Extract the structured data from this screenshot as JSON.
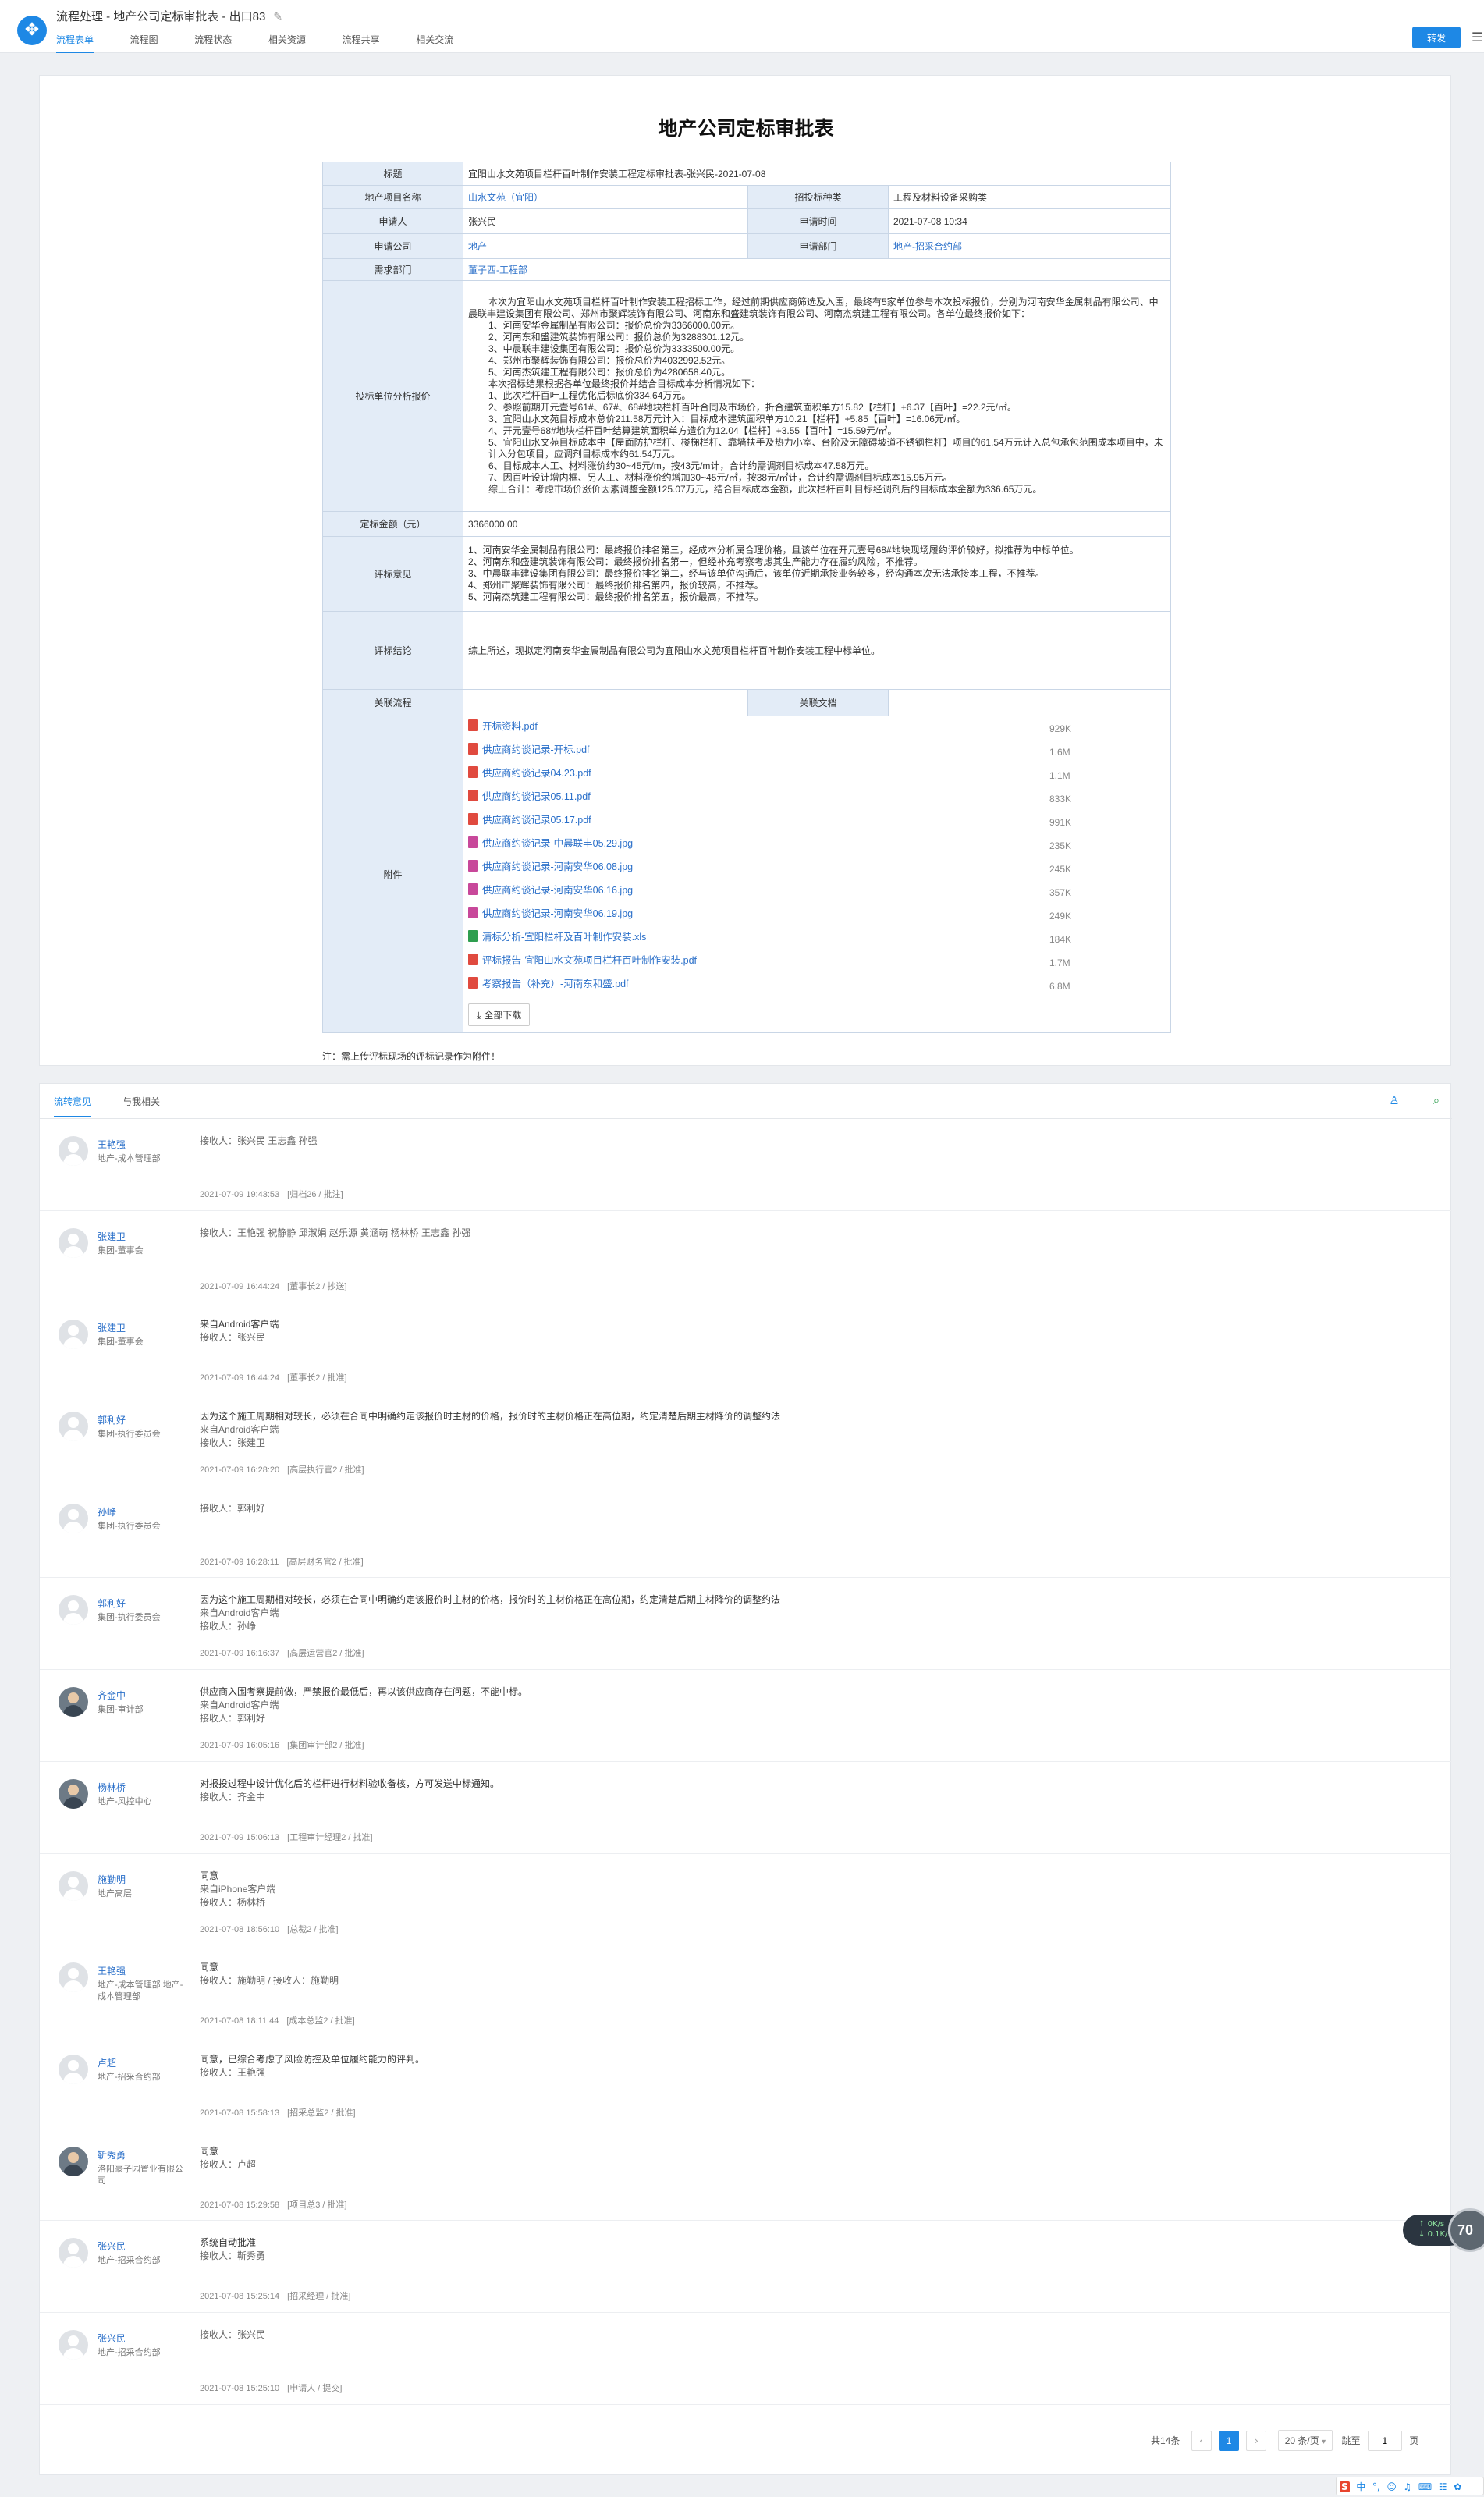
{
  "app": {
    "title": "流程处理 - 地产公司定标审批表 - 出口83",
    "edit_icon": "pencil-icon",
    "logo_icon": "workflow-logo-icon",
    "tabs": [
      "流程表单",
      "流程图",
      "流程状态",
      "相关资源",
      "流程共享",
      "相关交流"
    ],
    "forward_button": "转发",
    "menu_icon": "list-menu-icon",
    "accent_color": "#1e88e5"
  },
  "form": {
    "title": "地产公司定标审批表",
    "labels": {
      "subject": "标题",
      "project": "地产项目名称",
      "bid_type": "招投标种类",
      "applicant": "申请人",
      "apply_time": "申请时间",
      "company": "申请公司",
      "dept": "申请部门",
      "demand_dept": "需求部门",
      "analysis": "投标单位分析报价",
      "amount": "定标金额（元）",
      "opinion": "评标意见",
      "conclusion": "评标结论",
      "related_flow": "关联流程",
      "related_doc": "关联文档",
      "attachments": "附件"
    },
    "values": {
      "subject": "宜阳山水文苑项目栏杆百叶制作安装工程定标审批表-张兴民-2021-07-08",
      "project": "山水文苑（宜阳）",
      "bid_type": "工程及材料设备采购类",
      "applicant": "张兴民",
      "apply_time": "2021-07-08 10:34",
      "company": "地产",
      "dept": "地产-招采合约部",
      "demand_dept": "董子西-工程部",
      "amount": "3366000.00",
      "conclusion": "综上所述，现拟定河南安华金属制品有限公司为宜阳山水文苑项目栏杆百叶制作安装工程中标单位。",
      "related_flow": "",
      "related_doc": ""
    },
    "analysis": [
      "本次为宜阳山水文苑项目栏杆百叶制作安装工程招标工作，经过前期供应商筛选及入围，最终有5家单位参与本次投标报价，分别为河南安华金属制品有限公司、中晨联丰建设集团有限公司、郑州市聚辉装饰有限公司、河南东和盛建筑装饰有限公司、河南杰筑建工程有限公司。各单位最终报价如下：",
      "1、河南安华金属制品有限公司：报价总价为3366000.00元。",
      "2、河南东和盛建筑装饰有限公司：报价总价为3288301.12元。",
      "3、中晨联丰建设集团有限公司：报价总价为3333500.00元。",
      "4、郑州市聚辉装饰有限公司：报价总价为4032992.52元。",
      "5、河南杰筑建工程有限公司：报价总价为4280658.40元。",
      "本次招标结果根据各单位最终报价并结合目标成本分析情况如下：",
      "1、此次栏杆百叶工程优化后标底价334.64万元。",
      "2、参照前期开元壹号61#、67#、68#地块栏杆百叶合同及市场价，折合建筑面积单方15.82【栏杆】+6.37【百叶】=22.2元/㎡。",
      "3、宜阳山水文苑目标成本总价211.58万元计入：目标成本建筑面积单方10.21【栏杆】+5.85【百叶】=16.06元/㎡。",
      "4、开元壹号68#地块栏杆百叶结算建筑面积单方造价为12.04【栏杆】+3.55【百叶】=15.59元/㎡。",
      "5、宜阳山水文苑目标成本中【屋面防护栏杆、楼梯栏杆、靠墙扶手及热力小室、台阶及无障碍坡道不锈钢栏杆】项目的61.54万元计入总包承包范围成本项目中，未计入分包项目，应调剂目标成本约61.54万元。",
      "6、目标成本人工、材料涨价约30~45元/m，按43元/m计，合计约需调剂目标成本47.58万元。",
      "7、因百叶设计增内框、另人工、材料涨价约增加30~45元/㎡，按38元/㎡计，合计约需调剂目标成本15.95万元。",
      "综上合计：考虑市场价涨价因素调整金额125.07万元，结合目标成本金额，此次栏杆百叶目标经调剂后的目标成本金额为336.65万元。"
    ],
    "opinion": [
      "1、河南安华金属制品有限公司：最终报价排名第三，经成本分析属合理价格，且该单位在开元壹号68#地块现场履约评价较好，拟推荐为中标单位。",
      "2、河南东和盛建筑装饰有限公司：最终报价排名第一，但经补充考察考虑其生产能力存在履约风险，不推荐。",
      "3、中晨联丰建设集团有限公司：最终报价排名第二，经与该单位沟通后，该单位近期承接业务较多，经沟通本次无法承接本工程，不推荐。",
      "4、郑州市聚辉装饰有限公司：最终报价排名第四，报价较高，不推荐。",
      "5、河南杰筑建工程有限公司：最终报价排名第五，报价最高，不推荐。"
    ],
    "attachments": [
      {
        "name": "开标资料.pdf",
        "size": "929K",
        "kind": "pdf"
      },
      {
        "name": "供应商约谈记录-开标.pdf",
        "size": "1.6M",
        "kind": "pdf"
      },
      {
        "name": "供应商约谈记录04.23.pdf",
        "size": "1.1M",
        "kind": "pdf"
      },
      {
        "name": "供应商约谈记录05.11.pdf",
        "size": "833K",
        "kind": "pdf"
      },
      {
        "name": "供应商约谈记录05.17.pdf",
        "size": "991K",
        "kind": "pdf"
      },
      {
        "name": "供应商约谈记录-中晨联丰05.29.jpg",
        "size": "235K",
        "kind": "jpg"
      },
      {
        "name": "供应商约谈记录-河南安华06.08.jpg",
        "size": "245K",
        "kind": "jpg"
      },
      {
        "name": "供应商约谈记录-河南安华06.16.jpg",
        "size": "357K",
        "kind": "jpg"
      },
      {
        "name": "供应商约谈记录-河南安华06.19.jpg",
        "size": "249K",
        "kind": "jpg"
      },
      {
        "name": "清标分析-宜阳栏杆及百叶制作安装.xls",
        "size": "184K",
        "kind": "xls"
      },
      {
        "name": "评标报告-宜阳山水文苑项目栏杆百叶制作安装.pdf",
        "size": "1.7M",
        "kind": "pdf"
      },
      {
        "name": "考察报告（补充）-河南东和盛.pdf",
        "size": "6.8M",
        "kind": "pdf"
      }
    ],
    "file_colors": {
      "pdf": "#e04a3f",
      "jpg": "#c8489a",
      "xls": "#2e9e4f"
    },
    "download_all": "全部下载",
    "note": "注：需上传评标现场的评标记录作为附件！"
  },
  "flow": {
    "tabs": [
      "流转意见",
      "与我相关"
    ],
    "tool_icons": [
      "user-filter-icon",
      "search-icon"
    ],
    "entries": [
      {
        "name": "王艳强",
        "dept": "地产-成本管理部",
        "msg": [],
        "recv": "接收人：张兴民 王志鑫 孙强",
        "time": "2021-07-09 19:43:53",
        "step": "[归档26 / 批注]",
        "photo": false
      },
      {
        "name": "张建卫",
        "dept": "集团-董事会",
        "msg": [],
        "recv": "接收人：王艳强 祝静静 邱淑娟 赵乐源 黄涵萌 杨林桥 王志鑫 孙强",
        "time": "2021-07-09 16:44:24",
        "step": "[董事长2 / 抄送]",
        "photo": false
      },
      {
        "name": "张建卫",
        "dept": "集团-董事会",
        "msg": [
          "来自Android客户端"
        ],
        "recv": "接收人：张兴民",
        "time": "2021-07-09 16:44:24",
        "step": "[董事长2 / 批准]",
        "photo": false
      },
      {
        "name": "郭利好",
        "dept": "集团-执行委员会",
        "msg": [
          "因为这个施工周期相对较长，必须在合同中明确约定该报价时主材的价格，报价时的主材价格正在高位期，约定清楚后期主材降价的调整约法",
          "来自Android客户端"
        ],
        "recv": "接收人：张建卫",
        "time": "2021-07-09 16:28:20",
        "step": "[高层执行官2 / 批准]",
        "photo": false
      },
      {
        "name": "孙峥",
        "dept": "集团-执行委员会",
        "msg": [],
        "recv": "接收人：郭利好",
        "time": "2021-07-09 16:28:11",
        "step": "[高层财务官2 / 批准]",
        "photo": false
      },
      {
        "name": "郭利好",
        "dept": "集团-执行委员会",
        "msg": [
          "因为这个施工周期相对较长，必须在合同中明确约定该报价时主材的价格，报价时的主材价格正在高位期，约定清楚后期主材降价的调整约法",
          "来自Android客户端"
        ],
        "recv": "接收人：孙峥",
        "time": "2021-07-09 16:16:37",
        "step": "[高层运营官2 / 批准]",
        "photo": false
      },
      {
        "name": "齐金中",
        "dept": "集团-审计部",
        "msg": [
          "供应商入围考察提前做，严禁报价最低后，再以该供应商存在问题，不能中标。",
          "来自Android客户端"
        ],
        "recv": "接收人：郭利好",
        "time": "2021-07-09 16:05:16",
        "step": "[集团审计部2 / 批准]",
        "photo": true
      },
      {
        "name": "杨林桥",
        "dept": "地产-风控中心",
        "msg": [
          "对报投过程中设计优化后的栏杆进行材料验收备核，方可发送中标通知。"
        ],
        "recv": "接收人：齐金中",
        "time": "2021-07-09 15:06:13",
        "step": "[工程审计经理2 / 批准]",
        "photo": true
      },
      {
        "name": "施勤明",
        "dept": "地产高层",
        "msg": [
          "同意",
          "来自iPhone客户端"
        ],
        "recv": "接收人：杨林桥",
        "time": "2021-07-08 18:56:10",
        "step": "[总裁2 / 批准]",
        "photo": false
      },
      {
        "name": "王艳强",
        "dept": "地产-成本管理部 地产-成本管理部",
        "msg": [
          "同意"
        ],
        "recv": "接收人：施勤明 / 接收人：施勤明",
        "time": "2021-07-08 18:11:44",
        "step": "[成本总监2 / 批准]",
        "photo": false
      },
      {
        "name": "卢超",
        "dept": "地产-招采合约部",
        "msg": [
          "同意，已综合考虑了风险防控及单位履约能力的评判。"
        ],
        "recv": "接收人：王艳强",
        "time": "2021-07-08 15:58:13",
        "step": "[招采总监2 / 批准]",
        "photo": false
      },
      {
        "name": "靳秀勇",
        "dept": "洛阳豪子园置业有限公司",
        "msg": [
          "同意"
        ],
        "recv": "接收人：卢超",
        "time": "2021-07-08 15:29:58",
        "step": "[项目总3 / 批准]",
        "photo": true
      },
      {
        "name": "张兴民",
        "dept": "地产-招采合约部",
        "msg": [
          "系统自动批准"
        ],
        "recv": "接收人：靳秀勇",
        "time": "2021-07-08 15:25:14",
        "step": "[招采经理 / 批准]",
        "photo": false
      },
      {
        "name": "张兴民",
        "dept": "地产-招采合约部",
        "msg": [],
        "recv": "接收人：张兴民",
        "time": "2021-07-08 15:25:10",
        "step": "[申请人 / 提交]",
        "photo": false
      }
    ]
  },
  "pager": {
    "total": "共14条",
    "prev_icon": "chevron-left-icon",
    "current": "1",
    "next_icon": "chevron-right-icon",
    "page_size": "20 条/页",
    "goto_label": "跳至",
    "goto_value": "1",
    "page_unit": "页"
  },
  "widgets": {
    "net_up": "0K/s",
    "net_down": "0.1K/s",
    "net_percent": "70",
    "ime_logo": "S",
    "ime_items": [
      "中",
      "°,",
      "☺",
      "♫",
      "⌨",
      "☷",
      "✿"
    ]
  }
}
